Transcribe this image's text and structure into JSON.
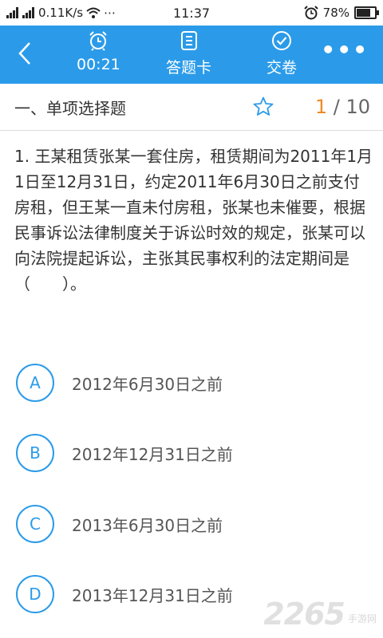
{
  "status_bar": {
    "network_speed": "0.11K/s",
    "more": "⋯",
    "time": "11:37",
    "battery": "78%"
  },
  "toolbar": {
    "timer": "00:21",
    "answer_card_label": "答题卡",
    "submit_label": "交卷",
    "more": "•••"
  },
  "section": {
    "title": "一、单项选择题",
    "current": "1",
    "separator": " / ",
    "total": "10"
  },
  "question": {
    "text": "1. 王某租赁张某一套住房，租赁期间为2011年1月1日至12月31日，约定2011年6月30日之前支付房租，但王某一直未付房租，张某也未催要，根据民事诉讼法律制度关于诉讼时效的规定，张某可以向法院提起诉讼，主张其民事权利的法定期间是（　　）。"
  },
  "options": [
    {
      "letter": "A",
      "text": "2012年6月30日之前"
    },
    {
      "letter": "B",
      "text": "2012年12月31日之前"
    },
    {
      "letter": "C",
      "text": "2013年6月30日之前"
    },
    {
      "letter": "D",
      "text": "2013年12月31日之前"
    }
  ],
  "watermark": {
    "number": "2265",
    "sub": "手游网"
  },
  "colors": {
    "accent": "#2b9be9",
    "progress_current": "#f08a24"
  }
}
